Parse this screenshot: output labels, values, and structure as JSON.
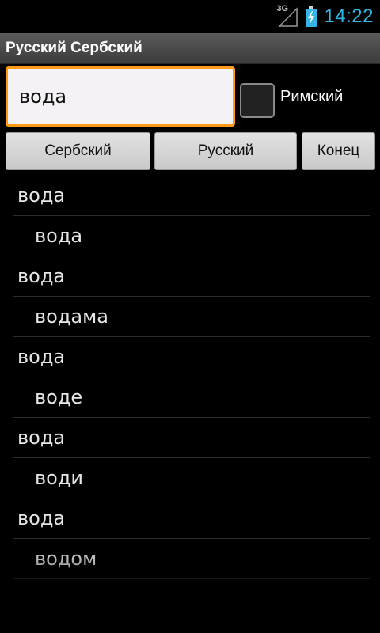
{
  "status_bar": {
    "network": "3G",
    "time": "14:22",
    "time_color": "#33b5e5"
  },
  "app": {
    "title": "Русский Сербский"
  },
  "search": {
    "value": "вода",
    "accent_color": "#ff9a1a"
  },
  "roman_checkbox": {
    "label": "Римский",
    "checked": false
  },
  "buttons": {
    "serbian": "Сербский",
    "russian": "Русский",
    "end": "Конец"
  },
  "results": [
    {
      "term": "вода",
      "translation": "вода"
    },
    {
      "term": "вода",
      "translation": "водама"
    },
    {
      "term": "вода",
      "translation": "воде"
    },
    {
      "term": "вода",
      "translation": "води"
    },
    {
      "term": "вода",
      "translation": "водом"
    }
  ]
}
